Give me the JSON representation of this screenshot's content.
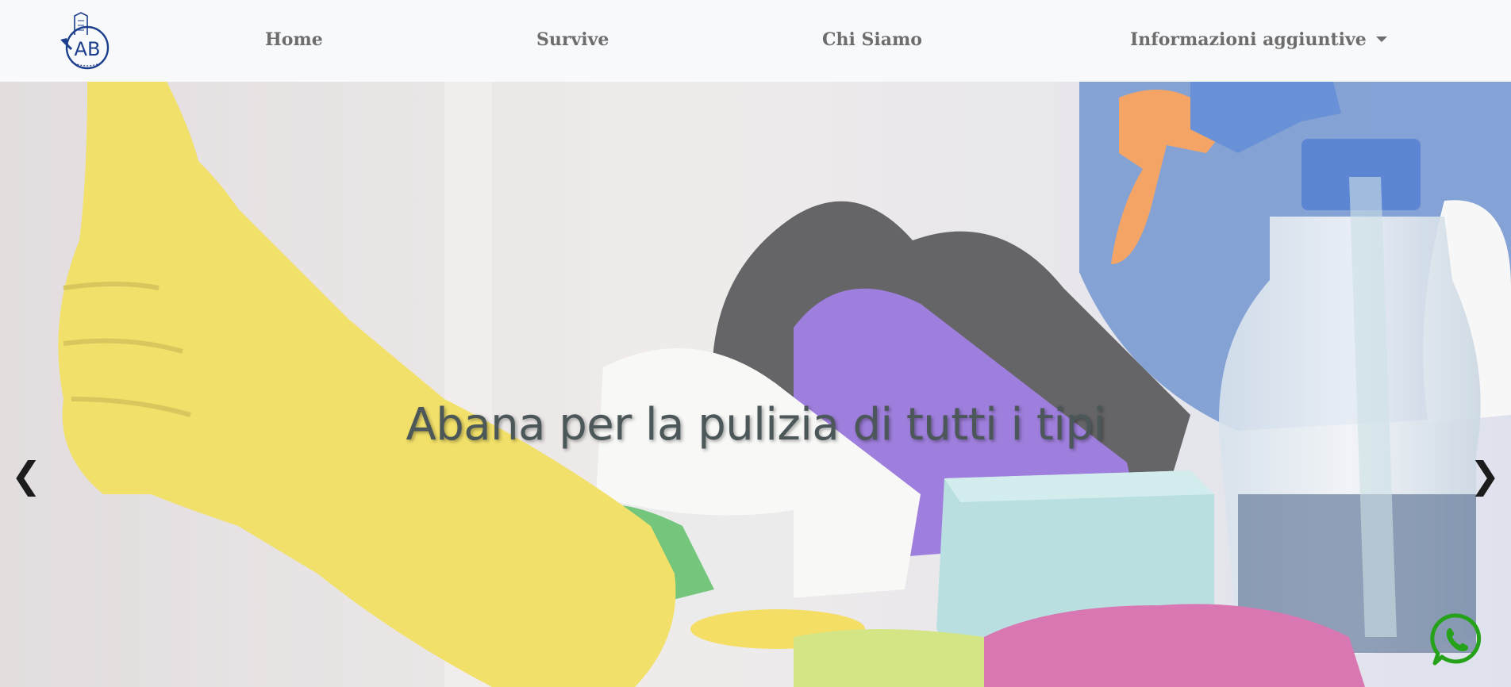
{
  "navbar": {
    "logo_icon": "ab-logo-icon",
    "items": [
      {
        "label": "Home"
      },
      {
        "label": "Survive"
      },
      {
        "label": "Chi Siamo"
      },
      {
        "label": "Informazioni aggiuntive",
        "icon": "caret-down-icon"
      }
    ]
  },
  "hero": {
    "title": "Abana per la pulizia di tutti i tipi",
    "prev_icon": "chevron-left-icon",
    "next_icon": "chevron-right-icon",
    "prev_glyph": "❮",
    "next_glyph": "❯"
  },
  "whatsapp": {
    "icon": "whatsapp-icon",
    "color": "#25a21a"
  },
  "colors": {
    "nav_bg": "#f8f9fb",
    "nav_text": "#6d6d6d",
    "logo_blue": "#1b3f8c",
    "title_text": "#4b5759"
  }
}
